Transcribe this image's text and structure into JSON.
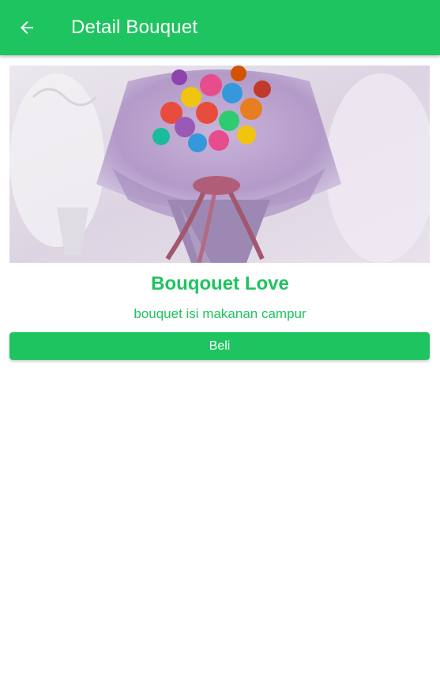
{
  "app_bar": {
    "title": "Detail Bouquet",
    "back_icon": "arrow-back-icon",
    "color": "#1ec45f"
  },
  "product": {
    "image_subject": "bouquet-photo",
    "name": "Bouqouet Love",
    "description": "bouquet isi makanan campur"
  },
  "actions": {
    "buy_label": "Beli"
  },
  "colors": {
    "accent": "#1ec45f",
    "on_accent": "#ffffff",
    "background": "#ffffff"
  }
}
